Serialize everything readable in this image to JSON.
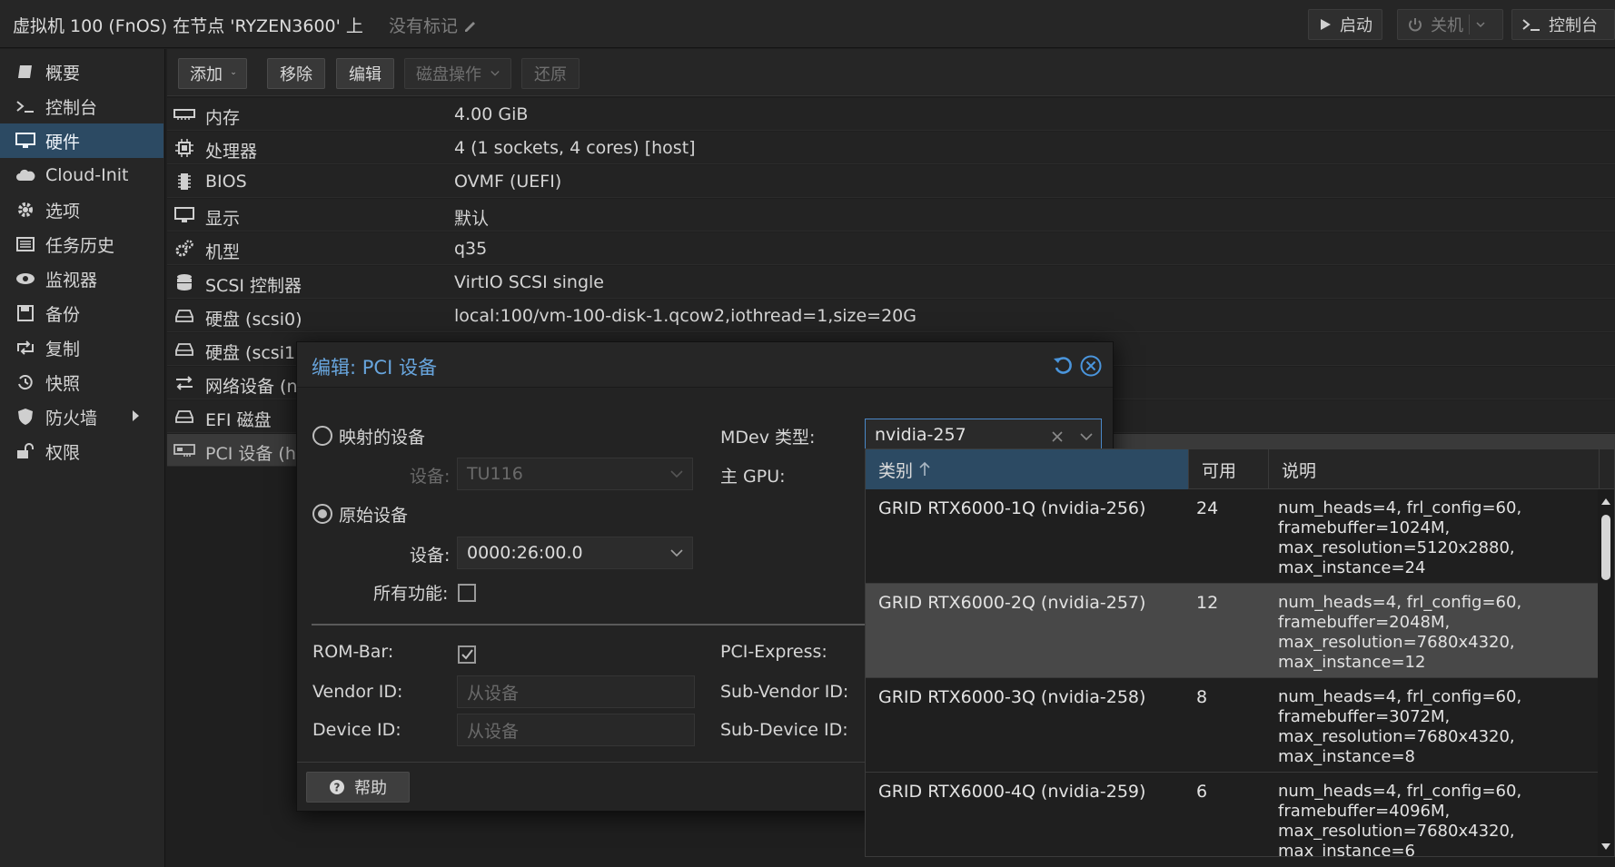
{
  "titlebar": {
    "title": "虚拟机 100 (FnOS) 在节点 'RYZEN3600' 上",
    "tags": "没有标记",
    "start": "启动",
    "shutdown": "关机",
    "console": "控制台"
  },
  "sidebar": {
    "items": [
      {
        "label": "概要",
        "icon": "book-icon"
      },
      {
        "label": "控制台",
        "icon": "terminal-icon"
      },
      {
        "label": "硬件",
        "icon": "monitor-icon",
        "active": true
      },
      {
        "label": "Cloud-Init",
        "icon": "cloud-icon"
      },
      {
        "label": "选项",
        "icon": "gear-icon"
      },
      {
        "label": "任务历史",
        "icon": "list-icon"
      },
      {
        "label": "监视器",
        "icon": "eye-icon"
      },
      {
        "label": "备份",
        "icon": "floppy-icon"
      },
      {
        "label": "复制",
        "icon": "retweet-icon"
      },
      {
        "label": "快照",
        "icon": "history-icon"
      },
      {
        "label": "防火墙",
        "icon": "shield-icon"
      },
      {
        "label": "权限",
        "icon": "unlock-icon"
      }
    ]
  },
  "toolbar": {
    "add": "添加",
    "remove": "移除",
    "edit": "编辑",
    "disk_action": "磁盘操作",
    "revert": "还原"
  },
  "hardware": {
    "rows": [
      {
        "label": "内存",
        "value": "4.00 GiB",
        "icon": "memory-icon"
      },
      {
        "label": "处理器",
        "value": "4 (1 sockets, 4 cores) [host]",
        "icon": "cpu-icon"
      },
      {
        "label": "BIOS",
        "value": "OVMF (UEFI)",
        "icon": "bios-icon"
      },
      {
        "label": "显示",
        "value": "默认",
        "icon": "display-icon"
      },
      {
        "label": "机型",
        "value": "q35",
        "icon": "cogs-icon"
      },
      {
        "label": "SCSI 控制器",
        "value": "VirtIO SCSI single",
        "icon": "database-icon"
      },
      {
        "label": "硬盘 (scsi0)",
        "value": "local:100/vm-100-disk-1.qcow2,iothread=1,size=20G",
        "icon": "hdd-icon"
      },
      {
        "label": "硬盘 (scsi1",
        "value": "",
        "icon": "hdd-icon"
      },
      {
        "label": "网络设备 (n",
        "value": "",
        "icon": "network-icon"
      },
      {
        "label": "EFI 磁盘",
        "value": "",
        "icon": "hdd-icon"
      },
      {
        "label": "PCI 设备 (h",
        "value": "",
        "icon": "pci-icon"
      }
    ]
  },
  "modal": {
    "title": "编辑: PCI 设备",
    "mapped_device": "映射的设备",
    "device_label": "设备:",
    "mapped_value": "TU116",
    "raw_device": "原始设备",
    "raw_value": "0000:26:00.0",
    "all_functions": "所有功能:",
    "mdev_label": "MDev 类型:",
    "mdev_value": "nvidia-257",
    "primary_gpu": "主 GPU:",
    "rom_bar": "ROM-Bar:",
    "pci_express": "PCI-Express:",
    "vendor_id": "Vendor ID:",
    "vendor_placeholder": "从设备",
    "sub_vendor_id": "Sub-Vendor ID:",
    "device_id": "Device ID:",
    "device_placeholder": "从设备",
    "sub_device_id": "Sub-Device ID:",
    "help": "帮助"
  },
  "mdev_list": {
    "headers": {
      "type": "类别",
      "available": "可用",
      "description": "说明"
    },
    "rows": [
      {
        "name": "GRID RTX6000-1Q (nvidia-256)",
        "available": "24",
        "desc": [
          "num_heads=4, frl_config=60,",
          "framebuffer=1024M,",
          "max_resolution=5120x2880,",
          "max_instance=24"
        ]
      },
      {
        "name": "GRID RTX6000-2Q (nvidia-257)",
        "available": "12",
        "desc": [
          "num_heads=4, frl_config=60,",
          "framebuffer=2048M,",
          "max_resolution=7680x4320,",
          "max_instance=12"
        ],
        "highlight": true
      },
      {
        "name": "GRID RTX6000-3Q (nvidia-258)",
        "available": "8",
        "desc": [
          "num_heads=4, frl_config=60,",
          "framebuffer=3072M,",
          "max_resolution=7680x4320,",
          "max_instance=8"
        ]
      },
      {
        "name": "GRID RTX6000-4Q (nvidia-259)",
        "available": "6",
        "desc": [
          "num_heads=4, frl_config=60,",
          "framebuffer=4096M,",
          "max_resolution=7680x4320,",
          "max_instance=6"
        ]
      }
    ]
  }
}
